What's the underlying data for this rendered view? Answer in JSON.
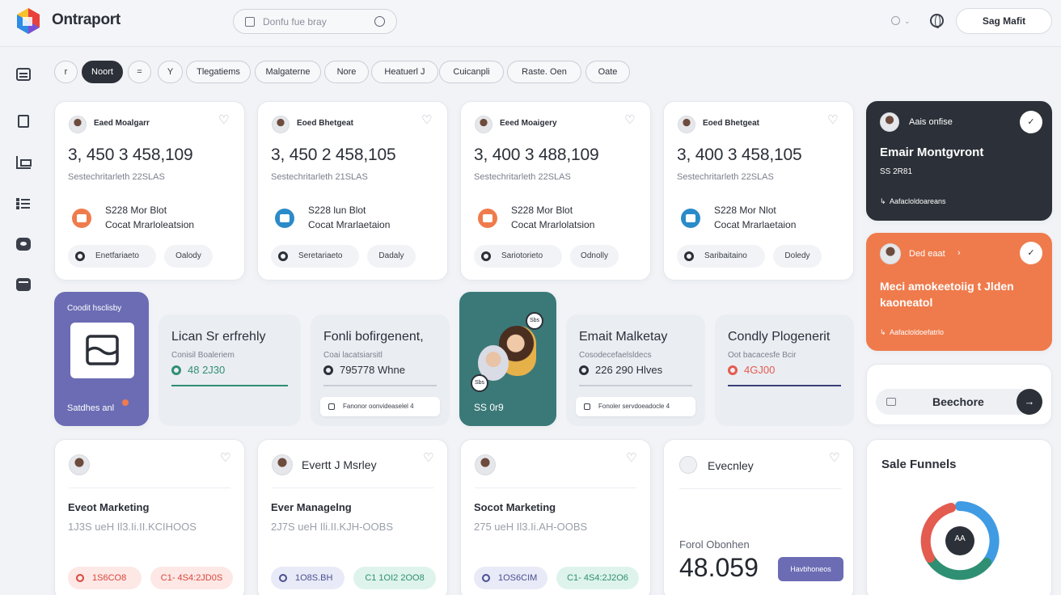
{
  "app": {
    "brand": "Ontraport",
    "search_placeholder": "Donfu fue bray",
    "sign_button": "Sag Mafit"
  },
  "colors": {
    "accent_dark": "#2c3038",
    "purple": "#6b6cb4",
    "teal": "#3b7979",
    "orange": "#ef7b4c",
    "green": "#2f8f72",
    "red": "#e45b4f"
  },
  "filters": [
    "r",
    "Noort",
    "=",
    "Y",
    "Tlegatiems",
    "Malgaterne",
    "Nore",
    "Heatuerl J",
    "Cuicanpli",
    "Raste. Oen",
    "Oate"
  ],
  "top_cards": [
    {
      "name": "Eaed Moalgarr",
      "big": "3, 450 3 458,109",
      "sub": "Sestechritarleth  22SLAS",
      "line1": "S228 Mor Blot",
      "line2": "Cocat Mrarloleatsion",
      "pill1": "Enetfariaeto",
      "pill2": "Oalody",
      "icon": "store-icon"
    },
    {
      "name": "Eoed Bhetgeat",
      "big": "3, 450 2 458,105",
      "sub": "Sestechritarleth  21SLAS",
      "line1": "S228 lun Blot",
      "line2": "Cocat Mrarlaetaion",
      "pill1": "Seretariaeto",
      "pill2": "Dadaly",
      "icon": "twitter-icon"
    },
    {
      "name": "Eeed Moaigery",
      "big": "3, 400 3 488,109",
      "sub": "Sestechritarleth  22SLAS",
      "line1": "S228 Mor Blot",
      "line2": "Cocat Mrarlolatsion",
      "pill1": "Sariotorieto",
      "pill2": "Odnolly",
      "icon": "store-icon"
    },
    {
      "name": "Eoed Bhetgeat",
      "big": "3, 400 3 458,105",
      "sub": "Sestechritarleth  22SLAS",
      "line1": "S228 Mor Nlot",
      "line2": "Cocat Mrarlaetaion",
      "pill1": "Saribaitaino",
      "pill2": "Doledy",
      "icon": "twitter-icon"
    }
  ],
  "right_cards": {
    "dark": {
      "name": "Aais onfise",
      "title": "Emair Montgvront",
      "sub": "SS 2R81",
      "foot": "Aafacloldoareans"
    },
    "orange": {
      "name": "Ded eaat",
      "title": "Meci amokeetoiig t Jlden kaoneatol",
      "foot": "Aafacloldoefatrlo"
    },
    "search": {
      "label": "Beechore"
    }
  },
  "mid_row": {
    "purple": {
      "label": "Coodit hsclisby",
      "foot": "Satdhes  anl"
    },
    "cards": [
      {
        "title": "Lican Sr erfrehly",
        "sub": "Conisil Boaleriem",
        "val": "48 2J30",
        "val_color": "#2f8f72"
      },
      {
        "title": "Fonli bofirgenent,",
        "sub": "Coai lacatsiarsitl",
        "val": "795778  Whne",
        "val_color": "#2b2f38",
        "tag": "Fanonor oonvideaselel 4"
      },
      {
        "title": "Emait Malketay",
        "sub": "Cosodecefaelsldecs",
        "val": "226 290  Hlves",
        "val_color": "#2b2f38",
        "tag": "Fonoler servdoeadocle 4"
      },
      {
        "title": "Condly Plogenerit",
        "sub": "Oot bacacesfe Bcir",
        "val": "4GJ00",
        "val_color": "#e45b4f"
      }
    ],
    "teal": {
      "label": "SS  0r9",
      "badge_top": "Sbs",
      "badge_bottom": "Sbs"
    }
  },
  "bottom_cards": [
    {
      "name": "",
      "title": "Eveot Marketing",
      "sub": "1J3S ueH Il3.Ii.II.KCIHOOS",
      "btn1": "1S6CO8",
      "btn2": "C1- 4S4:2JD0S",
      "btn1_color": "#fde8e6",
      "btn2_color": "#fde8e6",
      "btn1_text": "#d7463b",
      "btn2_text": "#d7463b"
    },
    {
      "name": "Evertt J Msrley",
      "title": "Ever Managelng",
      "sub": "2J7S ueH Ili.II.KJH-OOBS",
      "btn1": "1O8S.BH",
      "btn2": "C1  1OI2 2OO8",
      "btn1_color": "#e8eaf7",
      "btn2_color": "#def3ec",
      "btn1_text": "#4b4f8f",
      "btn2_text": "#2f8f72"
    },
    {
      "name": "",
      "title": "Socot Marketing",
      "sub": "275 ueH Il3.Ii.AH-OOBS",
      "btn1": "1OS6CIM",
      "btn2": "C1- 4S4:2J2O6",
      "btn1_color": "#e8eaf7",
      "btn2_color": "#def3ec",
      "btn1_text": "#4b4f8f",
      "btn2_text": "#2f8f72"
    }
  ],
  "evecney": {
    "name": "Evecnley",
    "label": "Forol Obonhen",
    "big": "48.059",
    "btn": "Havbhoneos"
  },
  "funnels": {
    "title": "Sale Funnels",
    "center": "AA"
  }
}
